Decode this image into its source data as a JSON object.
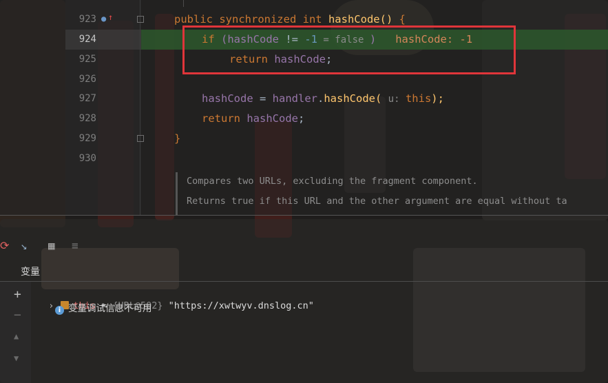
{
  "editor": {
    "line_numbers": [
      "923",
      "924",
      "925",
      "926",
      "927",
      "928",
      "929",
      "930"
    ],
    "lines": {
      "l923": {
        "kw1": "public synchronized ",
        "kw2": "int ",
        "fn": "hashCode",
        "paren": "() ",
        "brace": "{"
      },
      "l924": {
        "kw": "if ",
        "p1": "(",
        "field": "hashCode",
        " op": " != ",
        "num": "-1",
        "hint": " = false ",
        "p2": ")",
        "inline": "   hashCode: -1"
      },
      "l925": {
        "kw": "return ",
        "field": "hashCode",
        "semi": ";"
      },
      "l927": {
        "field": "hashCode",
        "eq": " = ",
        "obj": "handler",
        "dot": ".",
        "fn": "hashCode",
        "p1": "( ",
        "hint": "u: ",
        "self": "this",
        "p2": ");"
      },
      "l928": {
        "kw": "return ",
        "field": "hashCode",
        "semi": ";"
      },
      "l929": {
        "brace": "}"
      }
    },
    "doc": [
      "Compares two URLs, excluding the fragment component.",
      "Returns true if this URL and the other argument are equal without ta"
    ]
  },
  "debug_panel": {
    "tab_title": "变量",
    "variable": {
      "name": "this",
      "equals": " = ",
      "type": "{URL@502}",
      "value": " \"https://xwtwyv.dnslog.cn\""
    },
    "info_message": "变量调试信息不可用"
  },
  "colors": {
    "highlight_box": "#e0353a",
    "debug_line_bg": "#2d5a28",
    "keyword": "#cc7832",
    "field": "#9876aa",
    "number": "#6897bb"
  }
}
